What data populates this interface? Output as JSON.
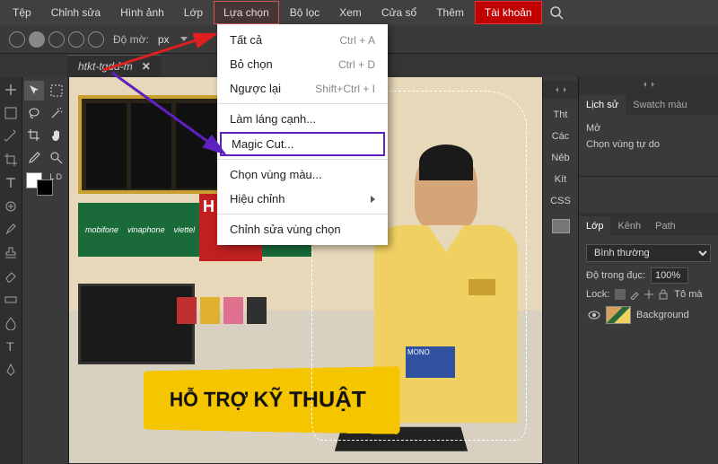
{
  "menubar": {
    "items": [
      "Tệp",
      "Chỉnh sửa",
      "Hình ảnh",
      "Lớp",
      "Lựa chọn",
      "Bộ lọc",
      "Xem",
      "Cửa sổ",
      "Thêm"
    ],
    "account": "Tài khoản"
  },
  "toolbar": {
    "opacity_label": "Độ mờ:",
    "opacity_value": "px"
  },
  "tab": {
    "title": "htkt-tgdd-m",
    "close": "✕"
  },
  "dropdown": {
    "select_all": {
      "label": "Tất cả",
      "shortcut": "Ctrl + A"
    },
    "deselect": {
      "label": "Bỏ chọn",
      "shortcut": "Ctrl + D"
    },
    "inverse": {
      "label": "Ngược lại",
      "shortcut": "Shift+Ctrl + I"
    },
    "refine_edge": {
      "label": "Làm láng cạnh..."
    },
    "magic_cut": {
      "label": "Magic Cut..."
    },
    "color_range": {
      "label": "Chọn vùng màu..."
    },
    "modify": {
      "label": "Hiệu chỉnh"
    },
    "edit_selection": {
      "label": "Chỉnh sửa vùng chọn"
    }
  },
  "right_strip": {
    "items": [
      "Tht",
      "Các",
      "Nẻb",
      "Kít",
      "CSS"
    ]
  },
  "history_panel": {
    "tabs": [
      "Lịch sử",
      "Swatch màu"
    ],
    "open": "Mở",
    "free_select": "Chọn vùng tự do"
  },
  "layers_panel": {
    "tabs": [
      "Lớp",
      "Kênh",
      "Path"
    ],
    "blend_mode": "Bình thường",
    "opacity_label": "Độ trong đục:",
    "opacity_value": "100%",
    "lock_label": "Lock:",
    "fill_label": "Tô mà",
    "layer_name": "Background"
  },
  "canvas": {
    "sign_text": "HỖ TRỢ KỸ THUẬT",
    "logo1": "mobifone",
    "logo2": "vinaphone",
    "logo3": "viettel",
    "poster": "H",
    "phonebox": "MONO"
  }
}
